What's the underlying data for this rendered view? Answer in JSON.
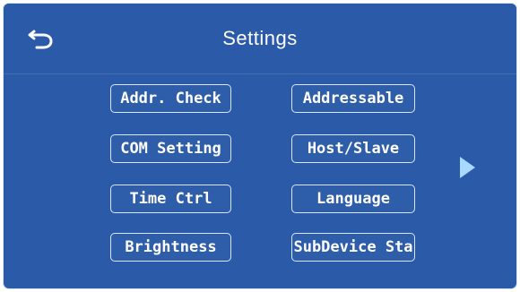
{
  "header": {
    "title": "Settings"
  },
  "icons": {
    "back": "back-arrow-icon",
    "next": "play-right-icon"
  },
  "buttons": {
    "addr_check": "Addr. Check",
    "addressable": "Addressable",
    "com_setting": "COM Setting",
    "host_slave": "Host/Slave",
    "time_ctrl": "Time Ctrl",
    "language": "Language",
    "brightness": "Brightness",
    "subdevice": "SubDevice Sta"
  },
  "colors": {
    "background": "#2a5aa8",
    "text": "#ffffff",
    "arrow": "#a9d9ff"
  }
}
